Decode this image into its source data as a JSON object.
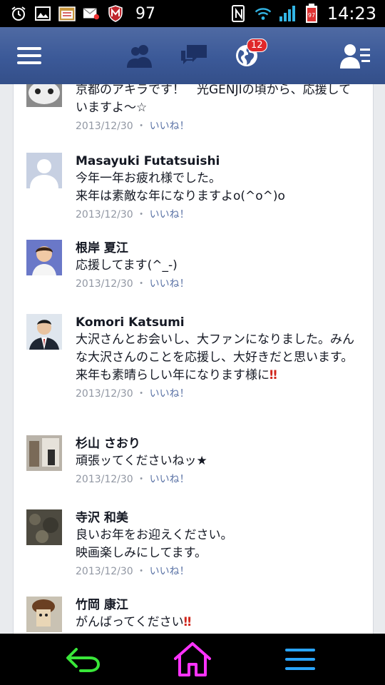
{
  "status": {
    "notif_count": "97",
    "time": "14:23",
    "battery": "97"
  },
  "nav": {
    "badge_count": "12"
  },
  "comments": [
    {
      "name": "",
      "text": "京都のアキラです！　光GENJIの頃から、応援していますよ〜☆",
      "date": "2013/12/30",
      "like": "いいね！"
    },
    {
      "name": "Masayuki Futatsuishi",
      "text": "今年一年お疲れ様でした。\n来年は素敵な年になりますよo(^o^)o",
      "date": "2013/12/30",
      "like": "いいね！"
    },
    {
      "name": "根岸 夏江",
      "text": "応援してます(^_-)",
      "date": "2013/12/30",
      "like": "いいね！"
    },
    {
      "name": "Komori Katsumi",
      "text": "大沢さんとお会いし、大ファンになりました。みんな大沢さんのことを応援し、大好きだと思います。来年も素晴らしい年になります様に",
      "bang": "‼",
      "date": "2013/12/30",
      "like": "いいね！"
    },
    {
      "name": "杉山 さおり",
      "text": "頑張ッてくださいねッ★",
      "date": "2013/12/30",
      "like": "いいね！"
    },
    {
      "name": "寺沢 和美",
      "text": "良いお年をお迎えください。\n映画楽しみにしてます。",
      "date": "2013/12/30",
      "like": "いいね！"
    },
    {
      "name": "竹岡 康江",
      "text": "がんばってください",
      "bang": "‼",
      "date": "",
      "like": ""
    }
  ],
  "separator": "・",
  "colors": {
    "header_blue": "#3b5998",
    "like_blue": "#5b73a6",
    "meta_gray": "#9197a3",
    "back_green": "#39e639",
    "home_magenta": "#ff33ff",
    "menu_blue": "#2aa5ff"
  }
}
